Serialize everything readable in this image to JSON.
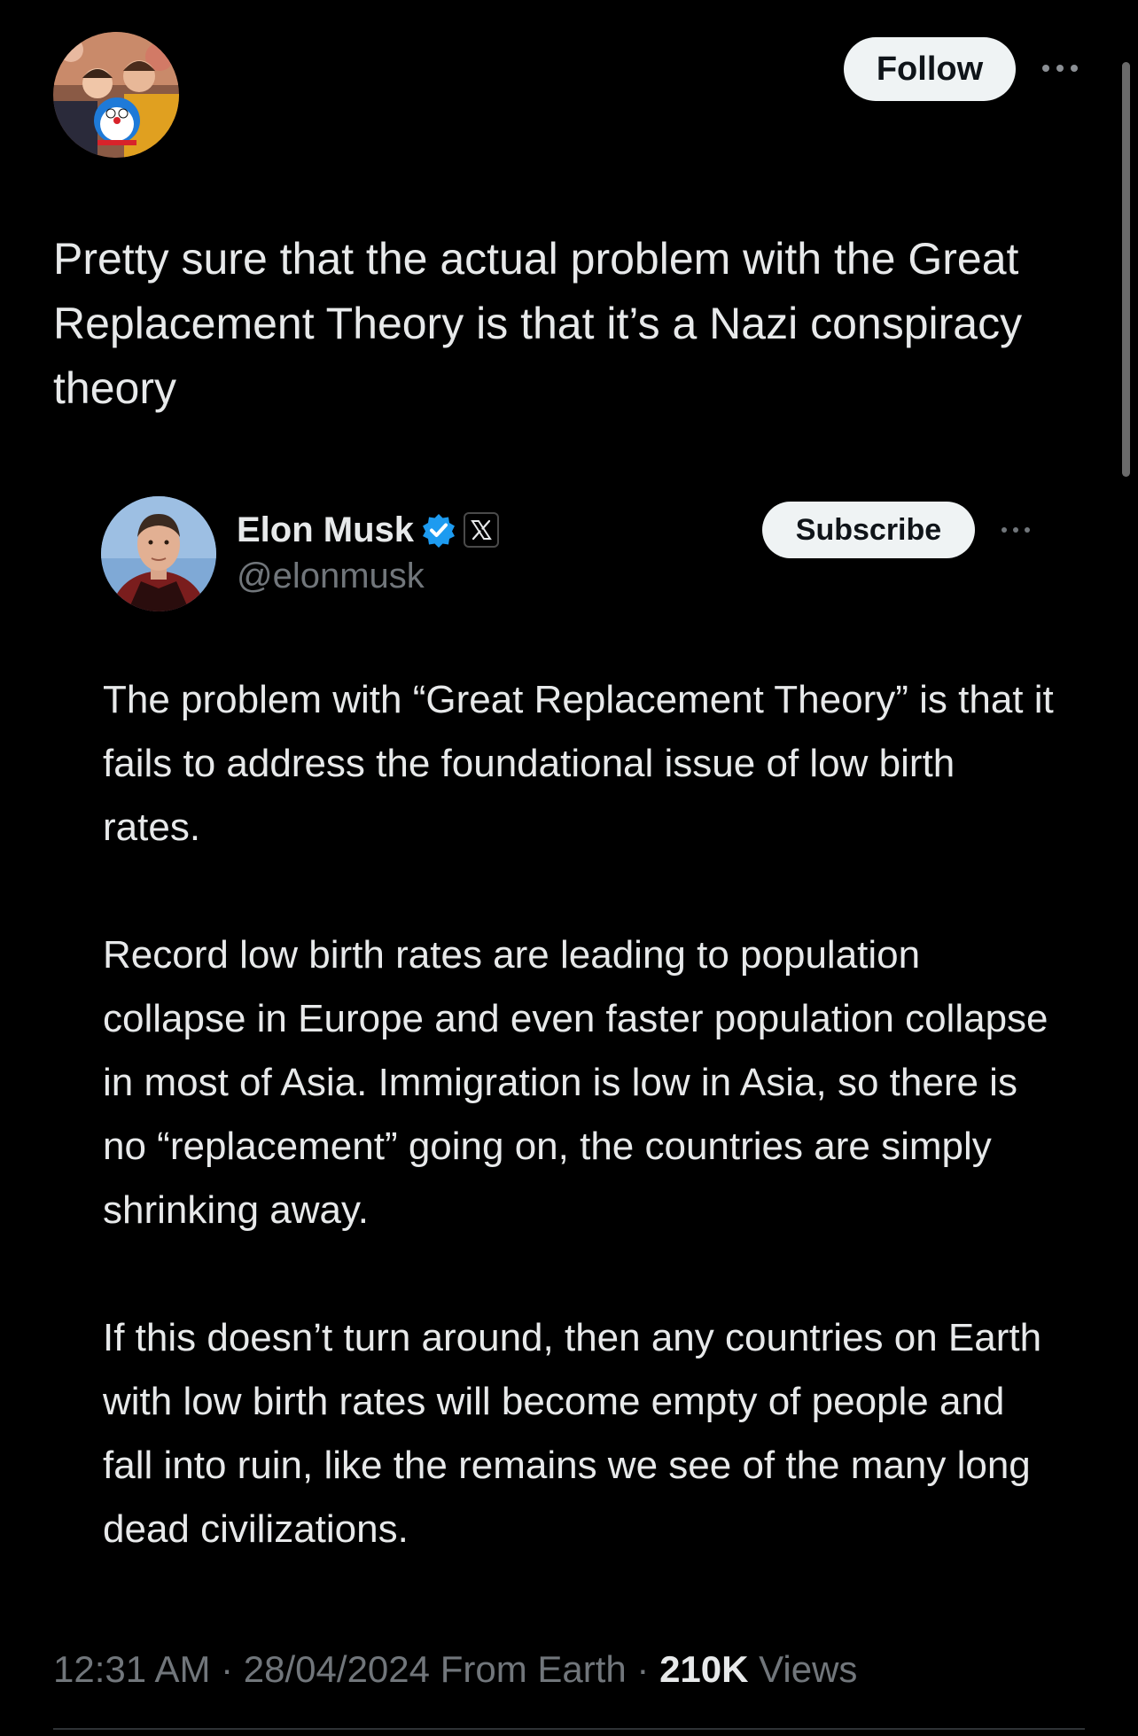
{
  "header": {
    "follow_label": "Follow"
  },
  "tweet": {
    "text": "Pretty sure that the actual problem with the Great Replacement Theory is that it’s a Nazi conspiracy theory"
  },
  "quoted": {
    "name": "Elon Musk",
    "handle": "@elonmusk",
    "subscribe_label": "Subscribe",
    "paragraphs": [
      "The problem with “Great Replacement Theory” is that it fails to address the foundational issue of low birth rates.",
      "Record low birth rates are leading to population collapse in Europe and even faster population collapse in most of Asia. Immigration is low in Asia, so there is no “replacement” going on, the countries are simply shrinking away.",
      "If this doesn’t turn around, then any countries on Earth with low birth rates will become empty of people and fall into ruin, like the remains we see of the many long dead civilizations."
    ]
  },
  "meta": {
    "time": "12:31 AM",
    "date": "28/04/2024",
    "source": "From Earth",
    "views_count": "210K",
    "views_label": "Views"
  },
  "icons": {
    "verified": "verified-badge-icon",
    "x_logo": "x-logo-icon",
    "more": "more-dots-icon"
  },
  "colors": {
    "background": "#000000",
    "text": "#e7e9ea",
    "secondary": "#71767b",
    "verified": "#1d9bf0",
    "button_bg": "#eff3f4"
  }
}
